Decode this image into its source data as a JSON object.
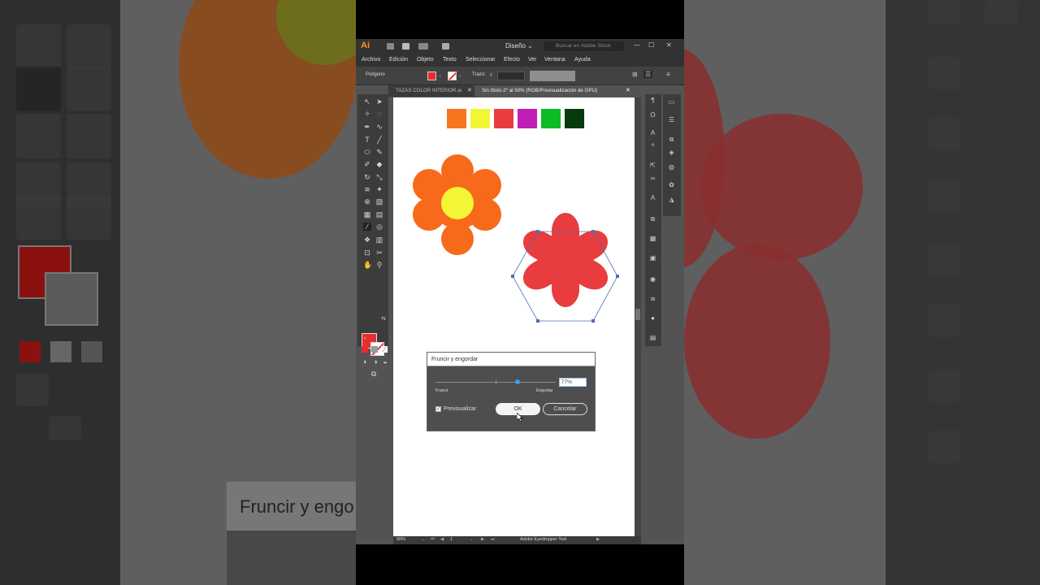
{
  "app": {
    "logo": "Ai",
    "workspace": "Diseño ⌄",
    "search_placeholder": "Buscar en Adobe Stock"
  },
  "menu": [
    "Archivo",
    "Edición",
    "Objeto",
    "Texto",
    "Seleccionar",
    "Efecto",
    "Ver",
    "Ventana",
    "Ayuda"
  ],
  "control_bar": {
    "object_type": "Polígono",
    "stroke_label": "Trazo:"
  },
  "tabs": [
    {
      "label": "TAZAS COLOR INTERIOR.ai",
      "active": false
    },
    {
      "label": "Sin título-2* al 50% (RGB/Previsualización de GPU)",
      "active": true
    }
  ],
  "swatches": [
    "#f7751e",
    "#f2f637",
    "#e83c3e",
    "#c11eb5",
    "#0dbc23",
    "#073a0c"
  ],
  "colors": {
    "fill": "#e62e2e",
    "flower_orange": "#f76a1b",
    "flower_center": "#f2f637",
    "flower_red": "#e83c3e",
    "accent_blue": "#3c9cf0"
  },
  "dialog": {
    "title": "Fruncir y engordar",
    "value": "77%",
    "value_fraction": 0.77,
    "min_label": "Fruncir",
    "max_label": "Engordar",
    "preview_label": "Previsualizar",
    "preview_checked": true,
    "ok_label": "OK",
    "cancel_label": "Cancelar"
  },
  "status": {
    "zoom": "50%",
    "artboard": "1",
    "tool": "Adobe Eyedropper Tool"
  },
  "background_dialog_title": "Fruncir y engo"
}
